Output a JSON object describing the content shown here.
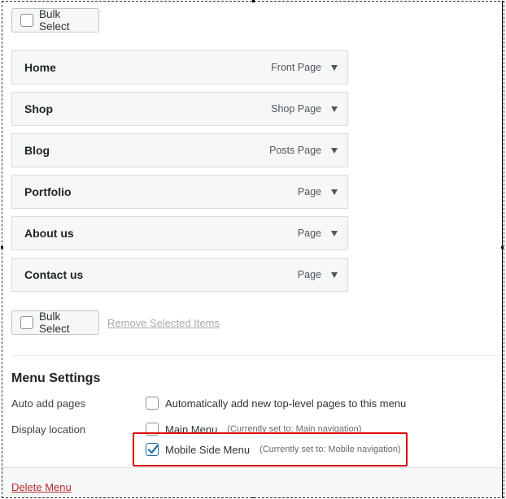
{
  "bulk_select_label": "Bulk Select",
  "menu_items": [
    {
      "title": "Home",
      "type": "Front Page"
    },
    {
      "title": "Shop",
      "type": "Shop Page"
    },
    {
      "title": "Blog",
      "type": "Posts Page"
    },
    {
      "title": "Portfolio",
      "type": "Page"
    },
    {
      "title": "About us",
      "type": "Page"
    },
    {
      "title": "Contact us",
      "type": "Page"
    }
  ],
  "remove_selected_label": "Remove Selected Items",
  "settings": {
    "title": "Menu Settings",
    "auto_add_label": "Auto add pages",
    "auto_add_option": "Automatically add new top-level pages to this menu",
    "auto_add_checked": false,
    "display_location_label": "Display location",
    "locations": [
      {
        "name": "Main Menu",
        "note": "(Currently set to: Main navigation)",
        "checked": false
      },
      {
        "name": "Mobile Side Menu",
        "note": "(Currently set to: Mobile navigation)",
        "checked": true
      }
    ]
  },
  "delete_menu_label": "Delete Menu",
  "colors": {
    "accent": "#2271b1",
    "highlight": "#e00000",
    "delete": "#b32d2e"
  }
}
